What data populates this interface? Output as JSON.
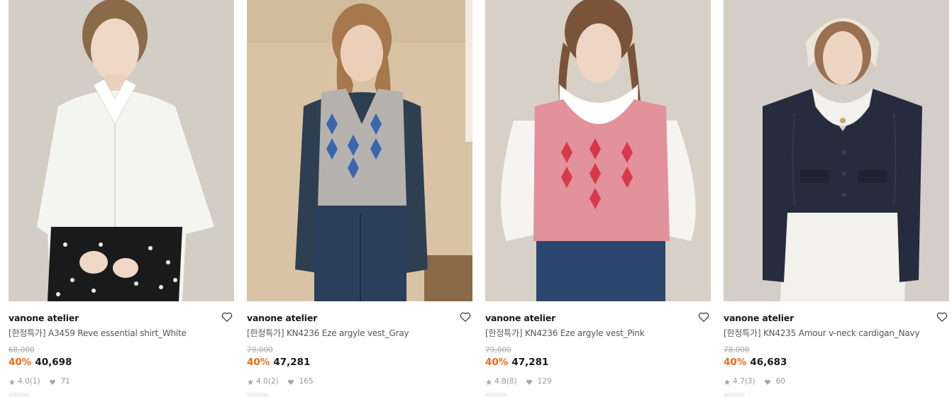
{
  "products": [
    {
      "brand": "vanone atelier",
      "name": "[한정특가] A3459 Reve essential shirt_White",
      "original_price": "68,000",
      "discount": "40%",
      "price": "40,698",
      "rating": "4.0",
      "reviews": "(1)",
      "likes": "71",
      "colors": {
        "bg": "#cfc9c0",
        "garment": "#f4f4f1",
        "accent": "#1a1a1a"
      }
    },
    {
      "brand": "vanone atelier",
      "name": "[한정특가] KN4236 Eze argyle vest_Gray",
      "original_price": "79,000",
      "discount": "40%",
      "price": "47,281",
      "rating": "4.0",
      "reviews": "(2)",
      "likes": "165",
      "colors": {
        "bg": "#d8c4a4",
        "garment": "#b6b2ad",
        "accent": "#3a66b0"
      }
    },
    {
      "brand": "vanone atelier",
      "name": "[한정특가] KN4236 Eze argyle vest_Pink",
      "original_price": "79,000",
      "discount": "40%",
      "price": "47,281",
      "rating": "4.8",
      "reviews": "(8)",
      "likes": "129",
      "colors": {
        "bg": "#d6d0c6",
        "garment": "#e3919a",
        "accent": "#d63a48"
      }
    },
    {
      "brand": "vanone atelier",
      "name": "[한정특가] KN4235 Amour v-neck cardigan_Navy",
      "original_price": "78,000",
      "discount": "40%",
      "price": "46,683",
      "rating": "4.7",
      "reviews": "(3)",
      "likes": "60",
      "colors": {
        "bg": "#d3cec7",
        "garment": "#262b3d",
        "accent": "#f2f1ec"
      }
    }
  ],
  "icons": {
    "wishlist": "heart-outline-icon",
    "rating": "star-icon",
    "likes": "heart-icon"
  },
  "theme": {
    "discount_color": "#f06a14"
  }
}
